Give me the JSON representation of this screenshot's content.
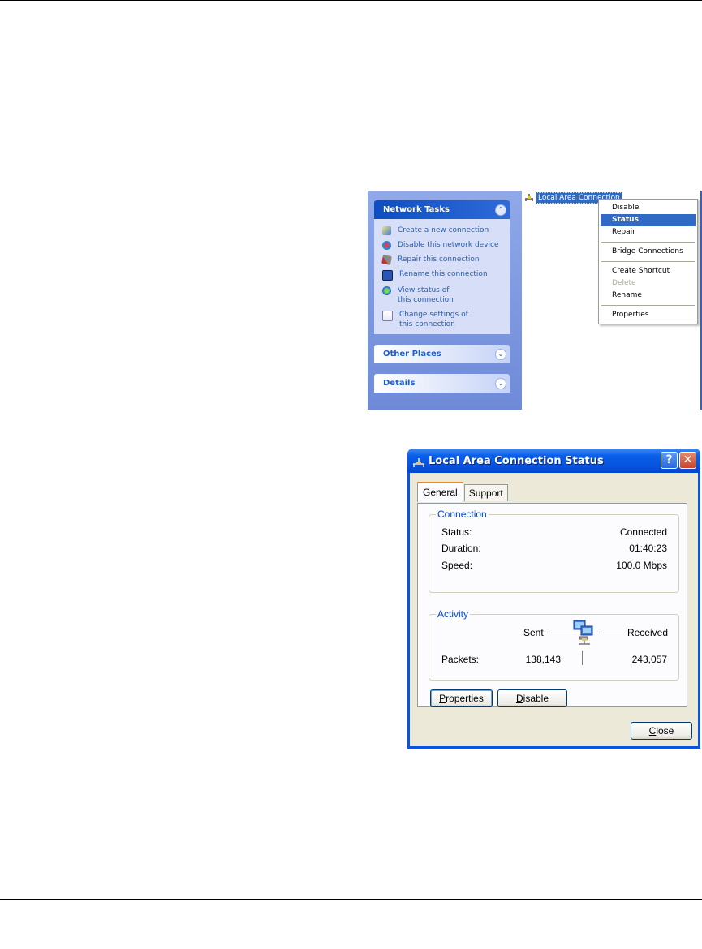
{
  "network_tasks": {
    "title": "Network Tasks",
    "items": [
      {
        "label": "Create a new connection",
        "icon": "new-connection-icon"
      },
      {
        "label": "Disable this network device",
        "icon": "disable-device-icon"
      },
      {
        "label": "Repair this connection",
        "icon": "repair-icon"
      },
      {
        "label": "Rename this connection",
        "icon": "rename-icon"
      },
      {
        "label": "View status of this connection",
        "icon": "view-status-icon"
      },
      {
        "label": "Change settings of this connection",
        "icon": "change-settings-icon"
      }
    ]
  },
  "other_places": {
    "title": "Other Places"
  },
  "details": {
    "title": "Details"
  },
  "connection_item": {
    "label": "Local Area Connection"
  },
  "context_menu": {
    "items": [
      "Disable",
      "Status",
      "Repair",
      "Bridge Connections",
      "Create Shortcut",
      "Delete",
      "Rename",
      "Properties"
    ],
    "highlighted": "Status",
    "disabled": [
      "Delete"
    ]
  },
  "status_dialog": {
    "title": "Local Area Connection Status",
    "help_button": "?",
    "close_button": "✕",
    "tabs": {
      "general": "General",
      "support": "Support"
    },
    "connection": {
      "label": "Connection",
      "status_key": "Status:",
      "status_val": "Connected",
      "duration_key": "Duration:",
      "duration_val": "01:40:23",
      "speed_key": "Speed:",
      "speed_val": "100.0 Mbps"
    },
    "activity": {
      "label": "Activity",
      "sent": "Sent",
      "received": "Received",
      "packets_key": "Packets:",
      "packets_sent": "138,143",
      "packets_received": "243,057"
    },
    "buttons": {
      "properties_mnemonic": "P",
      "properties_rest": "roperties",
      "disable_mnemonic": "D",
      "disable_rest": "isable",
      "close_mnemonic": "C",
      "close_rest": "lose"
    }
  },
  "colors": {
    "accent": "#316ac5",
    "title_bar": "#0a5ee8",
    "link": "#215dc6"
  }
}
